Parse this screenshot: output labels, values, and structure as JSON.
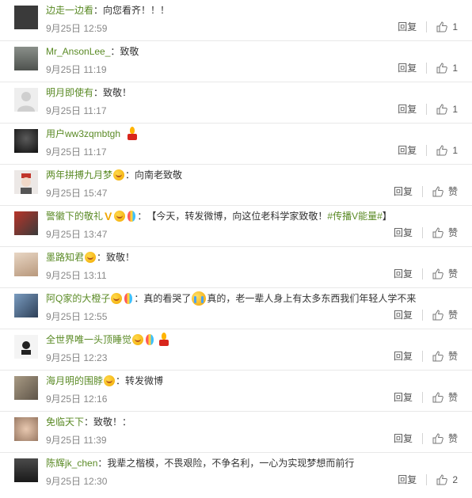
{
  "reply_label": "回复",
  "comments": [
    {
      "username": "边走一边看",
      "colon": "：",
      "content": "向您看齐！！！",
      "time": "9月25日 12:59",
      "like": "1",
      "avatar_color": "#3a3a3a"
    },
    {
      "username": "Mr_AnsonLee_",
      "colon": "：",
      "content": "致敬",
      "time": "9月25日 11:19",
      "like": "1",
      "avatar_color": "#6b6f6a"
    },
    {
      "username": "明月即使有",
      "colon": "：",
      "content": "致敬！",
      "time": "9月25日 11:17",
      "like": "1",
      "avatar_color": "#e6e6e6"
    },
    {
      "username": "用户ww3zqmbtgh",
      "colon": "",
      "content": "",
      "time": "9月25日 11:17",
      "like": "1",
      "avatar_color": "#1f1f1f"
    },
    {
      "username": "两年拼搏九月梦",
      "colon": "：",
      "content": "向南老致敬",
      "time": "9月25日 15:47",
      "like": "赞",
      "avatar_color": "#c7c2c0"
    },
    {
      "username": "警徽下的敬礼",
      "colon": "：",
      "content": "【今天，转发微博，向这位老科学家致敬！",
      "hashtag": "#传播V能量#",
      "content_end": "】",
      "time": "9月25日 13:47",
      "like": "赞",
      "avatar_color": "#a83a2c"
    },
    {
      "username": "墨路知君",
      "colon": "：",
      "content": "致敬！",
      "time": "9月25日 13:11",
      "like": "赞",
      "avatar_color": "#d9c4b0"
    },
    {
      "username": "阿Q家的大橙子",
      "colon": "：",
      "content": "真的看哭了",
      "content2": "真的，老一辈人身上有太多东西我们年轻人学不来",
      "time": "9月25日 12:55",
      "like": "赞",
      "avatar_color": "#4f6a8a"
    },
    {
      "username": "全世界唯一头顶睡觉",
      "colon": "",
      "content": "",
      "time": "9月25日 12:23",
      "like": "赞",
      "avatar_color": "#f2f2f2"
    },
    {
      "username": "海月明的围脖",
      "colon": "：",
      "content": "转发微博",
      "time": "9月25日 12:16",
      "like": "赞",
      "avatar_color": "#8a7f6d"
    },
    {
      "username": "免临天下",
      "colon": "：",
      "content": "致敬！：",
      "time": "9月25日 11:39",
      "like": "赞",
      "avatar_color": "#c6a28a"
    },
    {
      "username": "陈辉jk_chen",
      "colon": "：",
      "content": "我辈之楷模，不畏艰险，不争名利，一心为实现梦想而前行",
      "time": "9月25日 12:30",
      "like": "2",
      "avatar_color": "#2a2a2a"
    }
  ]
}
